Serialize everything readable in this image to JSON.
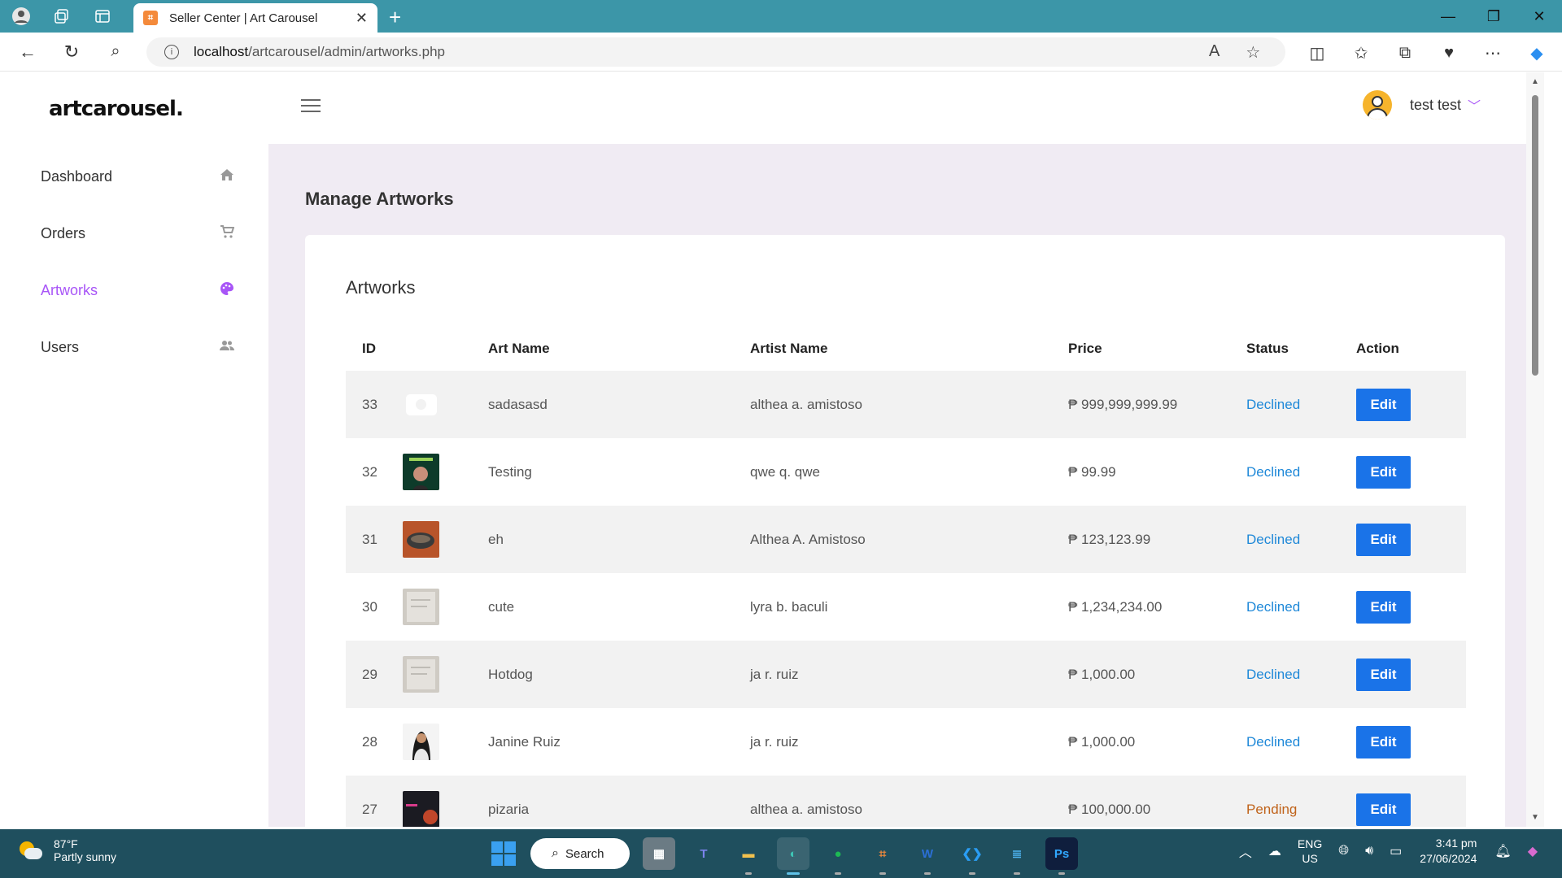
{
  "browser": {
    "tab_title": "Seller Center | Art Carousel",
    "url_host": "localhost",
    "url_path": "/artcarousel/admin/artworks.php"
  },
  "sidebar": {
    "logo": "artcarousel.",
    "items": [
      {
        "label": "Dashboard",
        "icon": "home-icon"
      },
      {
        "label": "Orders",
        "icon": "cart-icon"
      },
      {
        "label": "Artworks",
        "icon": "palette-icon",
        "active": true
      },
      {
        "label": "Users",
        "icon": "users-icon"
      }
    ]
  },
  "header": {
    "username": "test test"
  },
  "main": {
    "page_title": "Manage Artworks",
    "card_title": "Artworks",
    "columns": [
      "ID",
      "",
      "Art Name",
      "Artist Name",
      "Price",
      "Status",
      "Action"
    ],
    "rows": [
      {
        "id": "33",
        "art_name": "sadasasd",
        "artist": "althea a. amistoso",
        "price": "₱ 999,999,999.99",
        "status": "Declined",
        "action": "Edit",
        "thumb": "camera-placeholder"
      },
      {
        "id": "32",
        "art_name": "Testing",
        "artist": "qwe q. qwe",
        "price": "₱ 99.99",
        "status": "Declined",
        "action": "Edit",
        "thumb": "birthday-card"
      },
      {
        "id": "31",
        "art_name": "eh",
        "artist": "Althea A. Amistoso",
        "price": "₱ 123,123.99",
        "status": "Declined",
        "action": "Edit",
        "thumb": "food-photo"
      },
      {
        "id": "30",
        "art_name": "cute",
        "artist": "lyra b. baculi",
        "price": "₱ 1,234,234.00",
        "status": "Declined",
        "action": "Edit",
        "thumb": "paper-sketch"
      },
      {
        "id": "29",
        "art_name": "Hotdog",
        "artist": "ja r. ruiz",
        "price": "₱ 1,000.00",
        "status": "Declined",
        "action": "Edit",
        "thumb": "paper-sketch"
      },
      {
        "id": "28",
        "art_name": "Janine Ruiz",
        "artist": "ja r. ruiz",
        "price": "₱ 1,000.00",
        "status": "Declined",
        "action": "Edit",
        "thumb": "portrait"
      },
      {
        "id": "27",
        "art_name": "pizaria",
        "artist": "althea a. amistoso",
        "price": "₱ 100,000.00",
        "status": "Pending",
        "action": "Edit",
        "thumb": "pizza-poster"
      }
    ]
  },
  "taskbar": {
    "temp": "87°F",
    "weather": "Partly sunny",
    "search_label": "Search",
    "lang_top": "ENG",
    "lang_bottom": "US",
    "time": "3:41 pm",
    "date": "27/06/2024"
  },
  "colors": {
    "accent": "#a855f7",
    "edit_button": "#1a73e8",
    "declined": "#1e88d8",
    "pending": "#c0631a",
    "titlebar": "#3c96a8"
  }
}
